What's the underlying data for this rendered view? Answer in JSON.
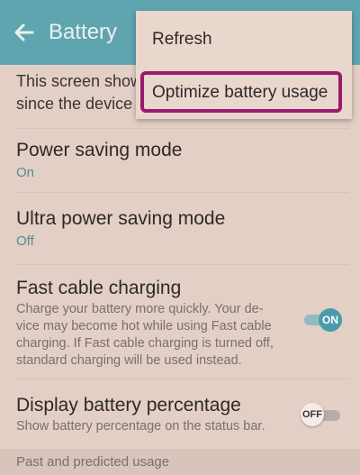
{
  "app_bar": {
    "back_icon": "arrow-left-icon",
    "title": "Battery",
    "color": "#5fa5b0"
  },
  "description": {
    "line1": "This screen show",
    "line2": "since the device"
  },
  "settings": [
    {
      "title": "Power saving mode",
      "value": "On"
    },
    {
      "title": "Ultra power saving mode",
      "value": "Off"
    },
    {
      "title": "Fast cable charging",
      "description": "Charge your battery more quickly. Your de-vice may become hot while using Fast cable charging. If Fast cable charging is turned off, standard charging will be used instead.",
      "toggle": "ON"
    },
    {
      "title": "Display battery percentage",
      "description": "Show battery percentage on the status bar.",
      "toggle": "OFF"
    }
  ],
  "section_header": "Past and predicted usage",
  "menu": {
    "items": [
      "Refresh",
      "Optimize battery usage"
    ],
    "highlight_color": "#9b1a6c"
  }
}
